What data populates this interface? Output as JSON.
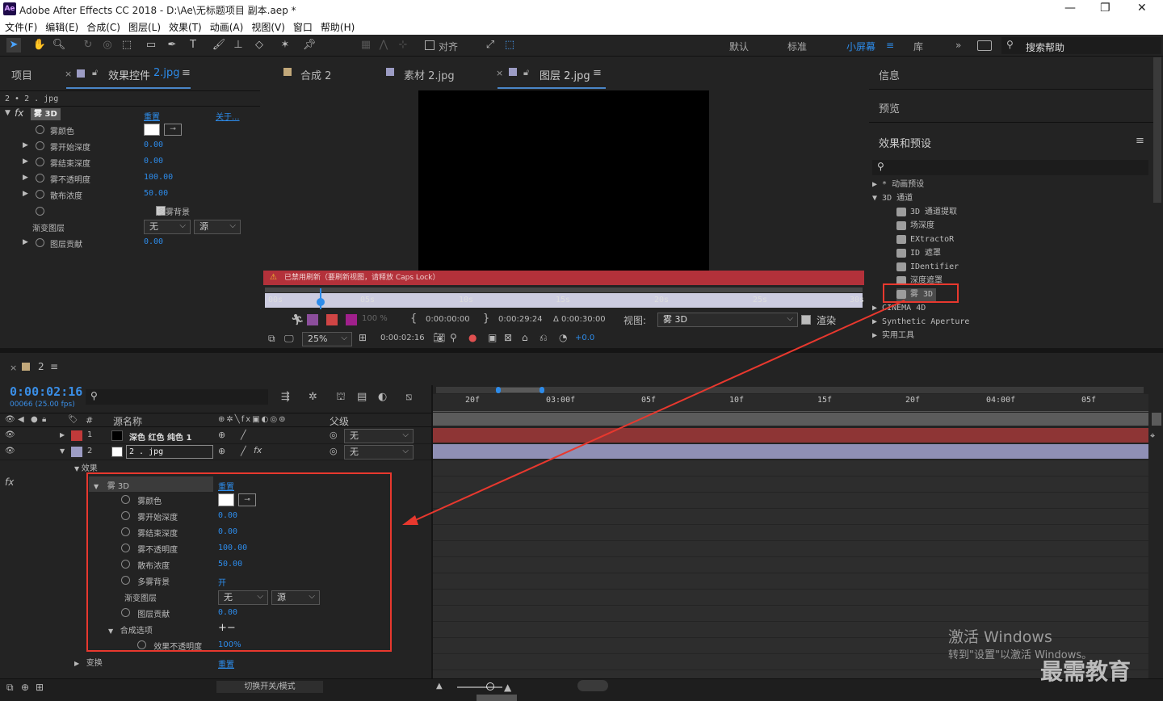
{
  "app": {
    "title": "Adobe After Effects CC 2018 - D:\\Ae\\无标题项目 副本.aep *",
    "logo": "Ae"
  },
  "menu": [
    "文件(F)",
    "编辑(E)",
    "合成(C)",
    "图层(L)",
    "效果(T)",
    "动画(A)",
    "视图(V)",
    "窗口",
    "帮助(H)"
  ],
  "toolbar": {
    "align_label": "对齐",
    "workspaces": [
      "默认",
      "标准",
      "小屏幕",
      "库"
    ],
    "active_workspace": "小屏幕",
    "search_help": "搜索帮助"
  },
  "left_panel": {
    "tab_project": "项目",
    "tab_effects": "效果控件",
    "tab_effects_target": "2.jpg",
    "breadcrumb": "2 • 2 . jpg",
    "effect_name": "雾 3D",
    "reset": "重置",
    "about": "关于...",
    "props": [
      {
        "name": "雾颜色",
        "value": ""
      },
      {
        "name": "雾开始深度",
        "value": "0.00"
      },
      {
        "name": "雾结束深度",
        "value": "0.00"
      },
      {
        "name": "雾不透明度",
        "value": "100.00"
      },
      {
        "name": "散布浓度",
        "value": "50.00"
      },
      {
        "name": "",
        "value": "多雾背景"
      },
      {
        "name": "渐变图层",
        "value": "无",
        "value2": "源"
      },
      {
        "name": "图层贡献",
        "value": "0.00"
      }
    ]
  },
  "viewer": {
    "tabs": [
      "合成 2",
      "素材 2.jpg",
      "图层 2.jpg"
    ],
    "warning": "已禁用刷新（要刷新视图，请释放 Caps Lock）",
    "ruler": [
      "00s",
      "05s",
      "10s",
      "15s",
      "20s",
      "25s",
      "30s"
    ],
    "zoom_pct": "100 %",
    "in_time": "0:00:00:00",
    "out_time": "0:00:29:24",
    "duration": "Δ 0:00:30:00",
    "view_label": "视图:",
    "view_value": "雾 3D",
    "render_label": "渲染",
    "mag": "25%",
    "current_time": "0:00:02:16",
    "exposure": "+0.0"
  },
  "right_panel": {
    "info": "信息",
    "preview": "预览",
    "effects_presets": "效果和预设",
    "search_placeholder": "",
    "tree": [
      {
        "label": "* 动画预设",
        "type": "folder",
        "open": false
      },
      {
        "label": "3D 通道",
        "type": "folder",
        "open": true
      },
      {
        "label": "3D 通道提取",
        "type": "effect"
      },
      {
        "label": "场深度",
        "type": "effect"
      },
      {
        "label": "EXtractoR",
        "type": "effect"
      },
      {
        "label": "ID 遮罩",
        "type": "effect"
      },
      {
        "label": "IDentifier",
        "type": "effect"
      },
      {
        "label": "深度遮罩",
        "type": "effect"
      },
      {
        "label": "雾 3D",
        "type": "effect",
        "selected": true
      },
      {
        "label": "CINEMA 4D",
        "type": "folder",
        "open": false
      },
      {
        "label": "Synthetic Aperture",
        "type": "folder",
        "open": false
      },
      {
        "label": "实用工具",
        "type": "folder",
        "open": false
      }
    ]
  },
  "timeline": {
    "comp_name": "2",
    "timecode": "0:00:02:16",
    "frame_info": "00066 (25.00 fps)",
    "col_hash": "#",
    "col_source": "源名称",
    "col_parent": "父级",
    "ruler": [
      "20f",
      "03:00f",
      "05f",
      "10f",
      "15f",
      "20f",
      "04:00f",
      "05f"
    ],
    "layers": [
      {
        "num": "1",
        "name": "深色 红色 纯色 1",
        "parent": "无",
        "color": "#c03a3a"
      },
      {
        "num": "2",
        "name": "2 . jpg",
        "parent": "无",
        "color": "#9c9cc4"
      }
    ],
    "effects_label": "效果",
    "effect_name": "雾 3D",
    "reset": "重置",
    "props": [
      {
        "name": "雾颜色",
        "value": ""
      },
      {
        "name": "雾开始深度",
        "value": "0.00"
      },
      {
        "name": "雾结束深度",
        "value": "0.00"
      },
      {
        "name": "雾不透明度",
        "value": "100.00"
      },
      {
        "name": "散布浓度",
        "value": "50.00"
      },
      {
        "name": "多雾背景",
        "value": "开"
      },
      {
        "name": "渐变图层",
        "value": "无",
        "value2": "源"
      },
      {
        "name": "图层贡献",
        "value": "0.00"
      }
    ],
    "composite_options": "合成选项",
    "effect_opacity": "效果不透明度",
    "effect_opacity_value": "100%",
    "transform": "变换",
    "transform_reset": "重置",
    "toggle_modes": "切换开关/模式"
  },
  "watermark": {
    "activate_title": "激活 Windows",
    "activate_sub": "转到\"设置\"以激活 Windows。",
    "brand": "最需教育"
  },
  "colors": {
    "accent": "#2d8ceb",
    "highlight_box": "#e8382e",
    "layer1_bar": "#8e3535",
    "layer2_bar": "#8f8fb5"
  }
}
